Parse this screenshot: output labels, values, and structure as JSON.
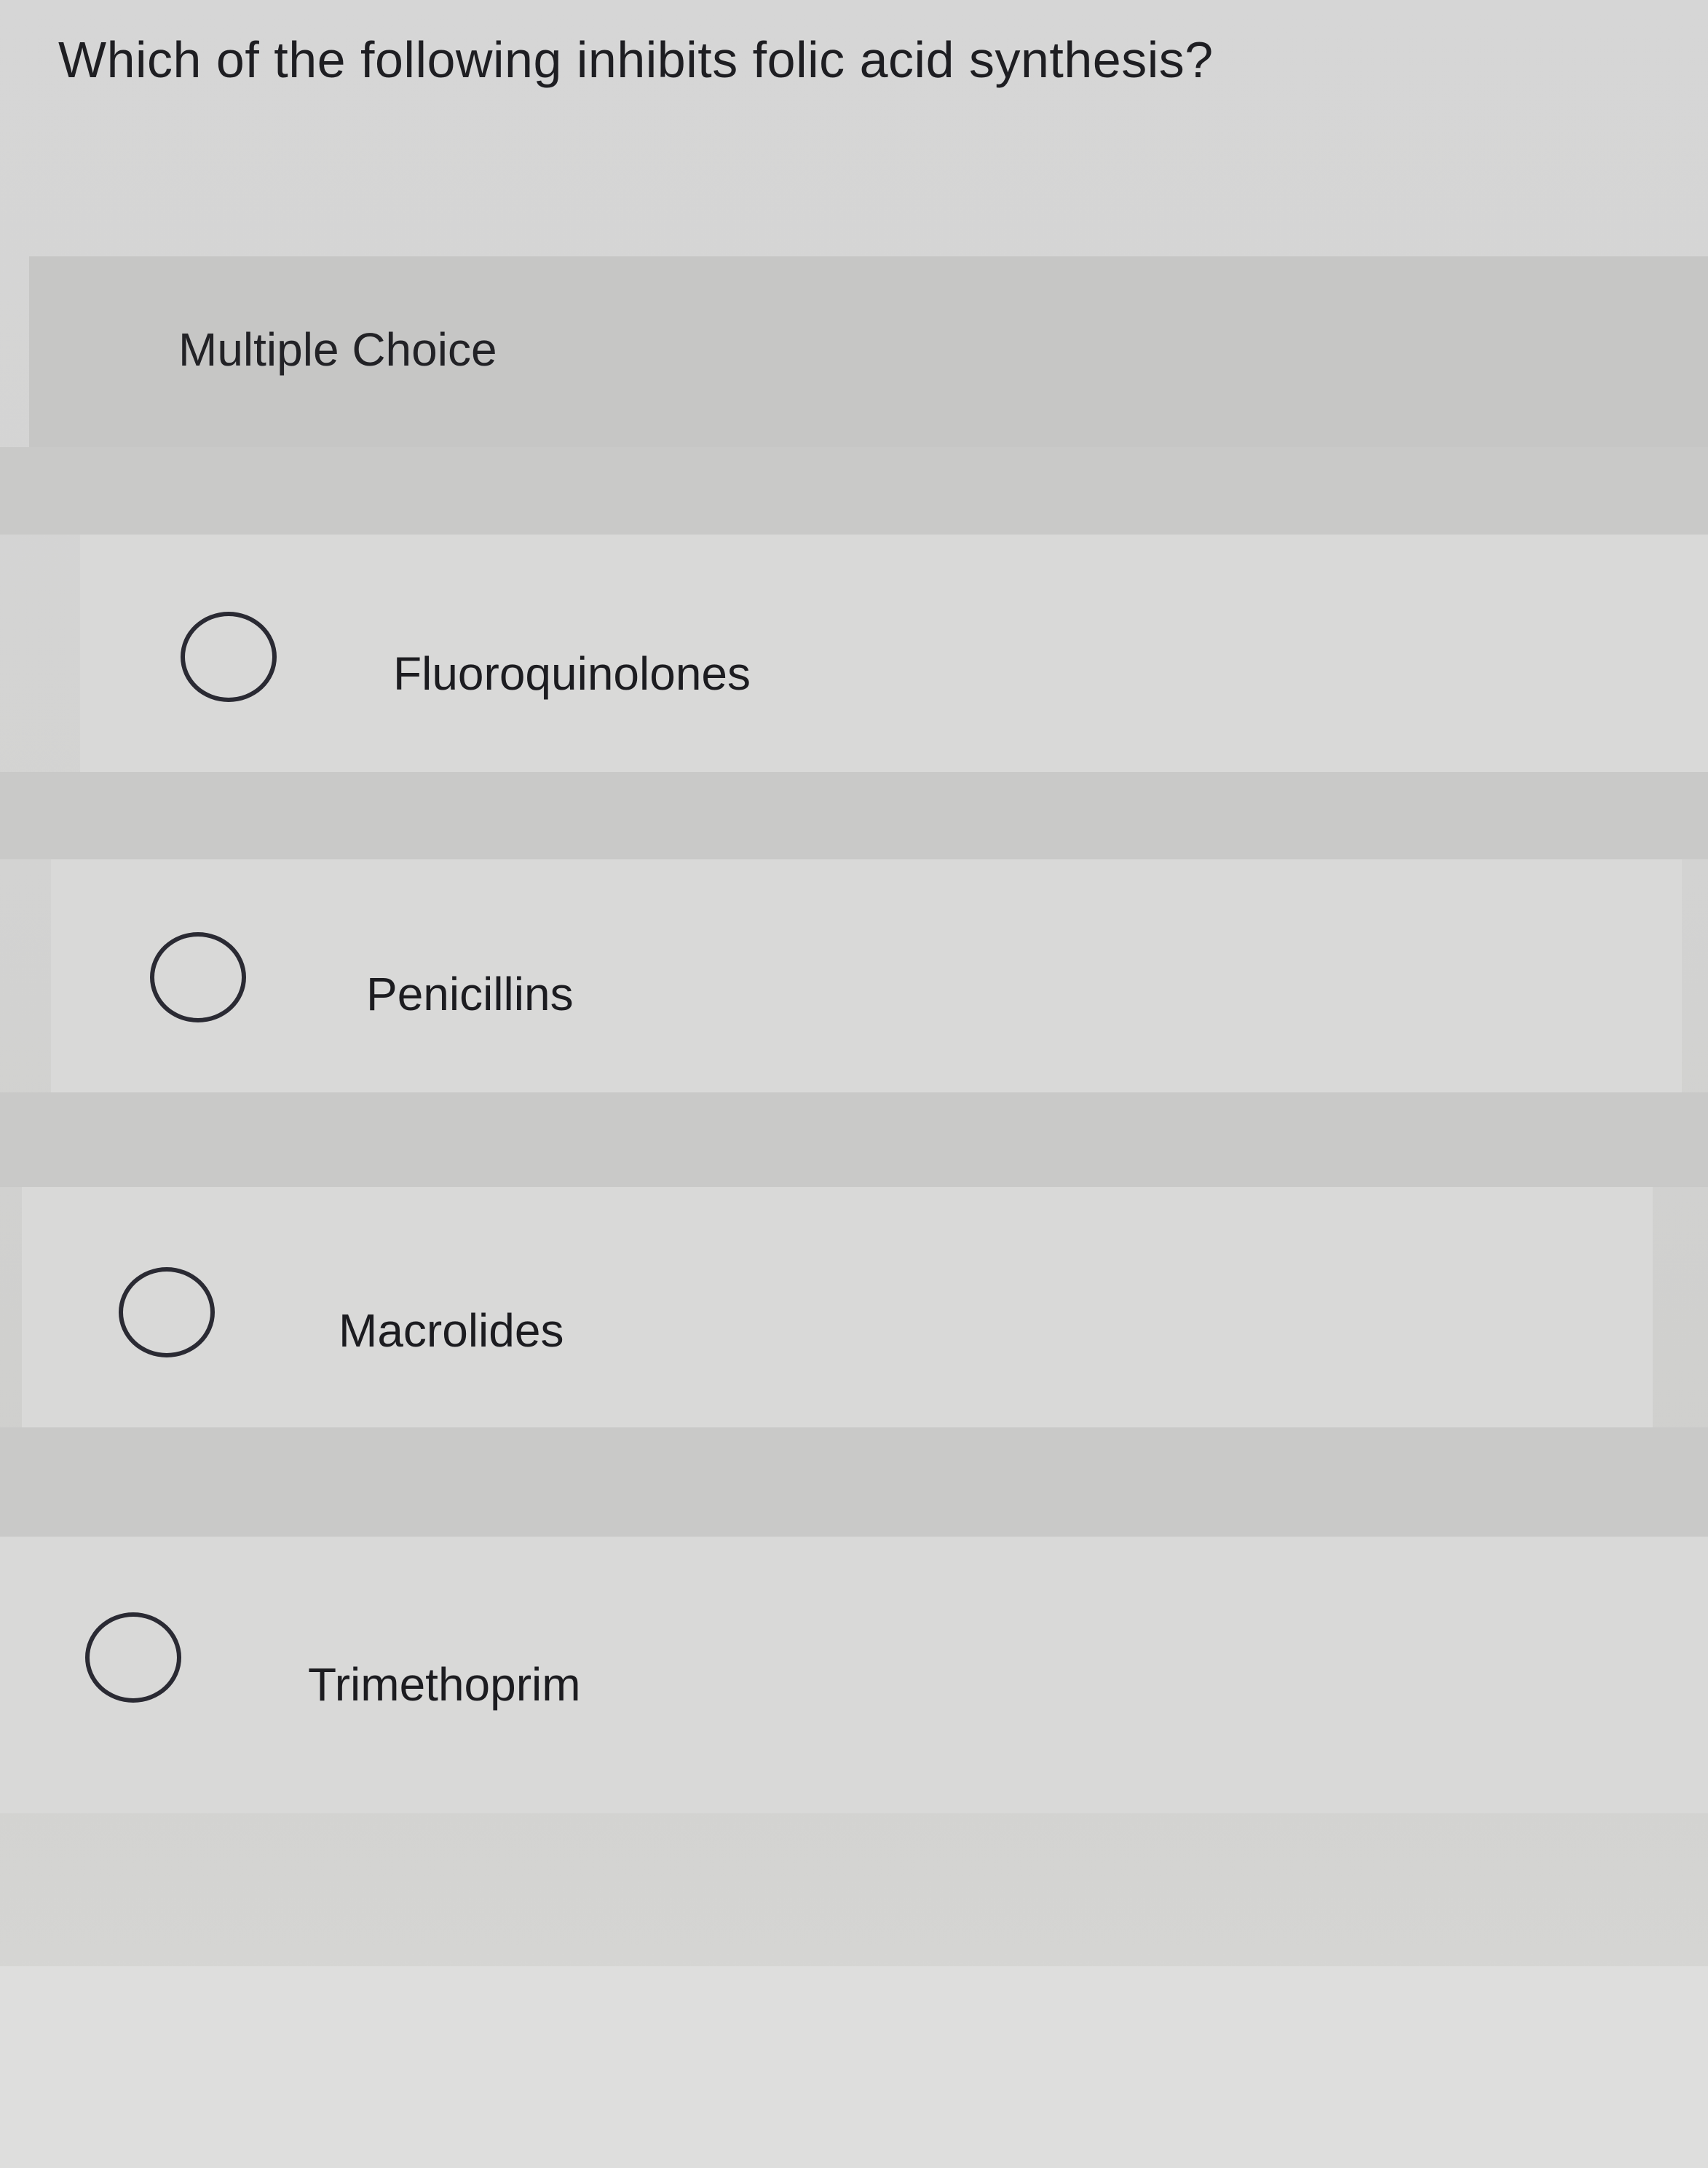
{
  "question": {
    "text": "Which of the following inhibits folic acid synthesis?"
  },
  "section": {
    "label": "Multiple Choice"
  },
  "options": [
    {
      "label": "Fluoroquinolones",
      "selected": false
    },
    {
      "label": "Penicillins",
      "selected": false
    },
    {
      "label": "Macrolides",
      "selected": false
    },
    {
      "label": "Trimethoprim",
      "selected": false
    }
  ]
}
